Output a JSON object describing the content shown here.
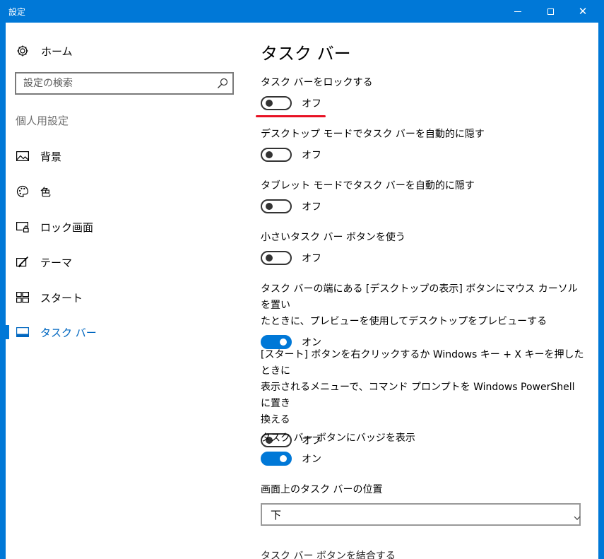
{
  "window": {
    "title": "設定",
    "minimize_icon": "minimize-icon",
    "maximize_icon": "maximize-icon",
    "close_icon": "close-icon"
  },
  "sidebar": {
    "home": {
      "label": "ホーム",
      "icon": "gear-icon"
    },
    "search": {
      "placeholder": "設定の検索",
      "value": "",
      "icon": "search-icon"
    },
    "section_title": "個人用設定",
    "items": [
      {
        "label": "背景",
        "icon": "picture-icon"
      },
      {
        "label": "色",
        "icon": "palette-icon"
      },
      {
        "label": "ロック画面",
        "icon": "lock-screen-icon"
      },
      {
        "label": "テーマ",
        "icon": "theme-brush-icon"
      },
      {
        "label": "スタート",
        "icon": "start-tiles-icon"
      },
      {
        "label": "タスク バー",
        "icon": "taskbar-icon",
        "selected": true
      }
    ]
  },
  "content": {
    "title": "タスク バー",
    "settings": [
      {
        "label": "タスク バーをロックする",
        "state": "オフ",
        "on": false,
        "highlighted": true
      },
      {
        "label": "デスクトップ モードでタスク バーを自動的に隠す",
        "state": "オフ",
        "on": false
      },
      {
        "label": "タブレット モードでタスク バーを自動的に隠す",
        "state": "オフ",
        "on": false
      },
      {
        "label": "小さいタスク バー ボタンを使う",
        "state": "オフ",
        "on": false
      },
      {
        "label_lines": [
          "タスク バーの端にある [デスクトップの表示] ボタンにマウス カーソルを置い",
          "たときに、プレビューを使用してデスクトップをプレビューする"
        ],
        "state": "オン",
        "on": true
      },
      {
        "label_lines": [
          "[スタート] ボタンを右クリックするか Windows キー + X キーを押したときに",
          "表示されるメニューで、コマンド プロンプトを Windows PowerShell に置き",
          "換える"
        ],
        "state": "オフ",
        "on": false
      },
      {
        "label": "タスク バー ボタンにバッジを表示",
        "state": "オン",
        "on": true
      }
    ],
    "position_setting": {
      "label": "画面上のタスク バーの位置",
      "value": "下"
    },
    "next_label_partial": "タスク バー ボタンを結合する"
  },
  "colors": {
    "accent": "#0078d7",
    "highlight_underline": "#e81123",
    "selected_text": "#0067c0"
  }
}
